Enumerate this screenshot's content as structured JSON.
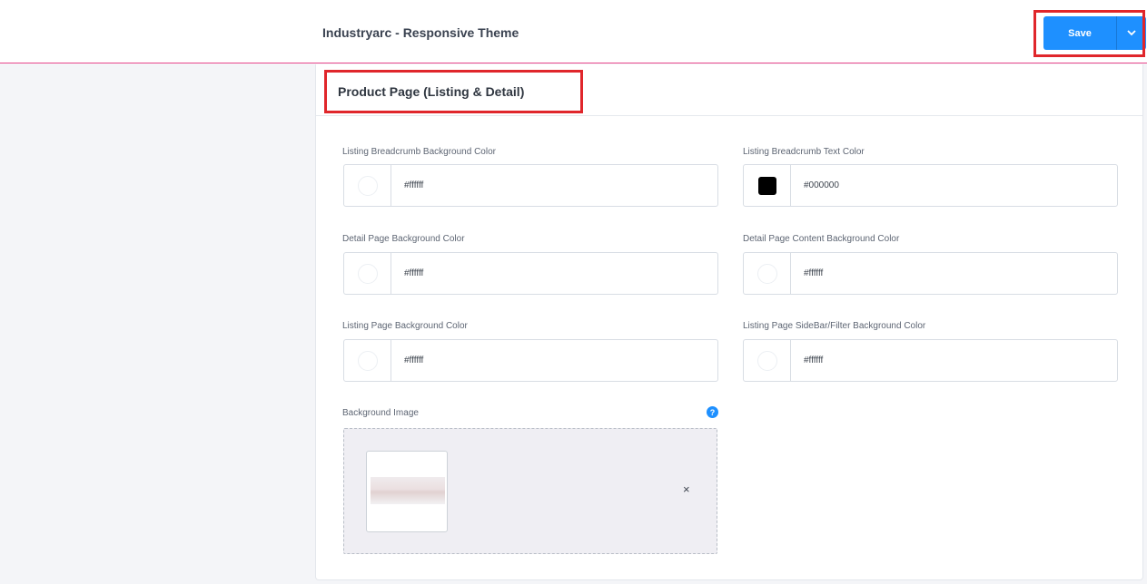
{
  "header": {
    "title": "Industryarc - Responsive Theme",
    "save_label": "Save",
    "save_caret_icon": "chevron-down-icon"
  },
  "panel": {
    "title": "Product Page (Listing & Detail)",
    "fields": [
      {
        "label": "Listing Breadcrumb Background Color",
        "value": "#ffffff",
        "swatch": "#ffffff"
      },
      {
        "label": "Listing Breadcrumb Text Color",
        "value": "#000000",
        "swatch": "#000000"
      },
      {
        "label": "Detail Page Background Color",
        "value": "#ffffff",
        "swatch": "#ffffff"
      },
      {
        "label": "Detail Page Content Background Color",
        "value": "#ffffff",
        "swatch": "#ffffff"
      },
      {
        "label": "Listing Page Background Color",
        "value": "#ffffff",
        "swatch": "#ffffff"
      },
      {
        "label": "Listing Page SideBar/Filter Background Color",
        "value": "#ffffff",
        "swatch": "#ffffff"
      }
    ],
    "background_image": {
      "label": "Background Image",
      "help_icon": "question-icon",
      "remove_glyph": "×"
    }
  },
  "colors": {
    "accent": "#1e90ff",
    "highlight": "#e0262b",
    "header_rule": "#e8458b"
  }
}
